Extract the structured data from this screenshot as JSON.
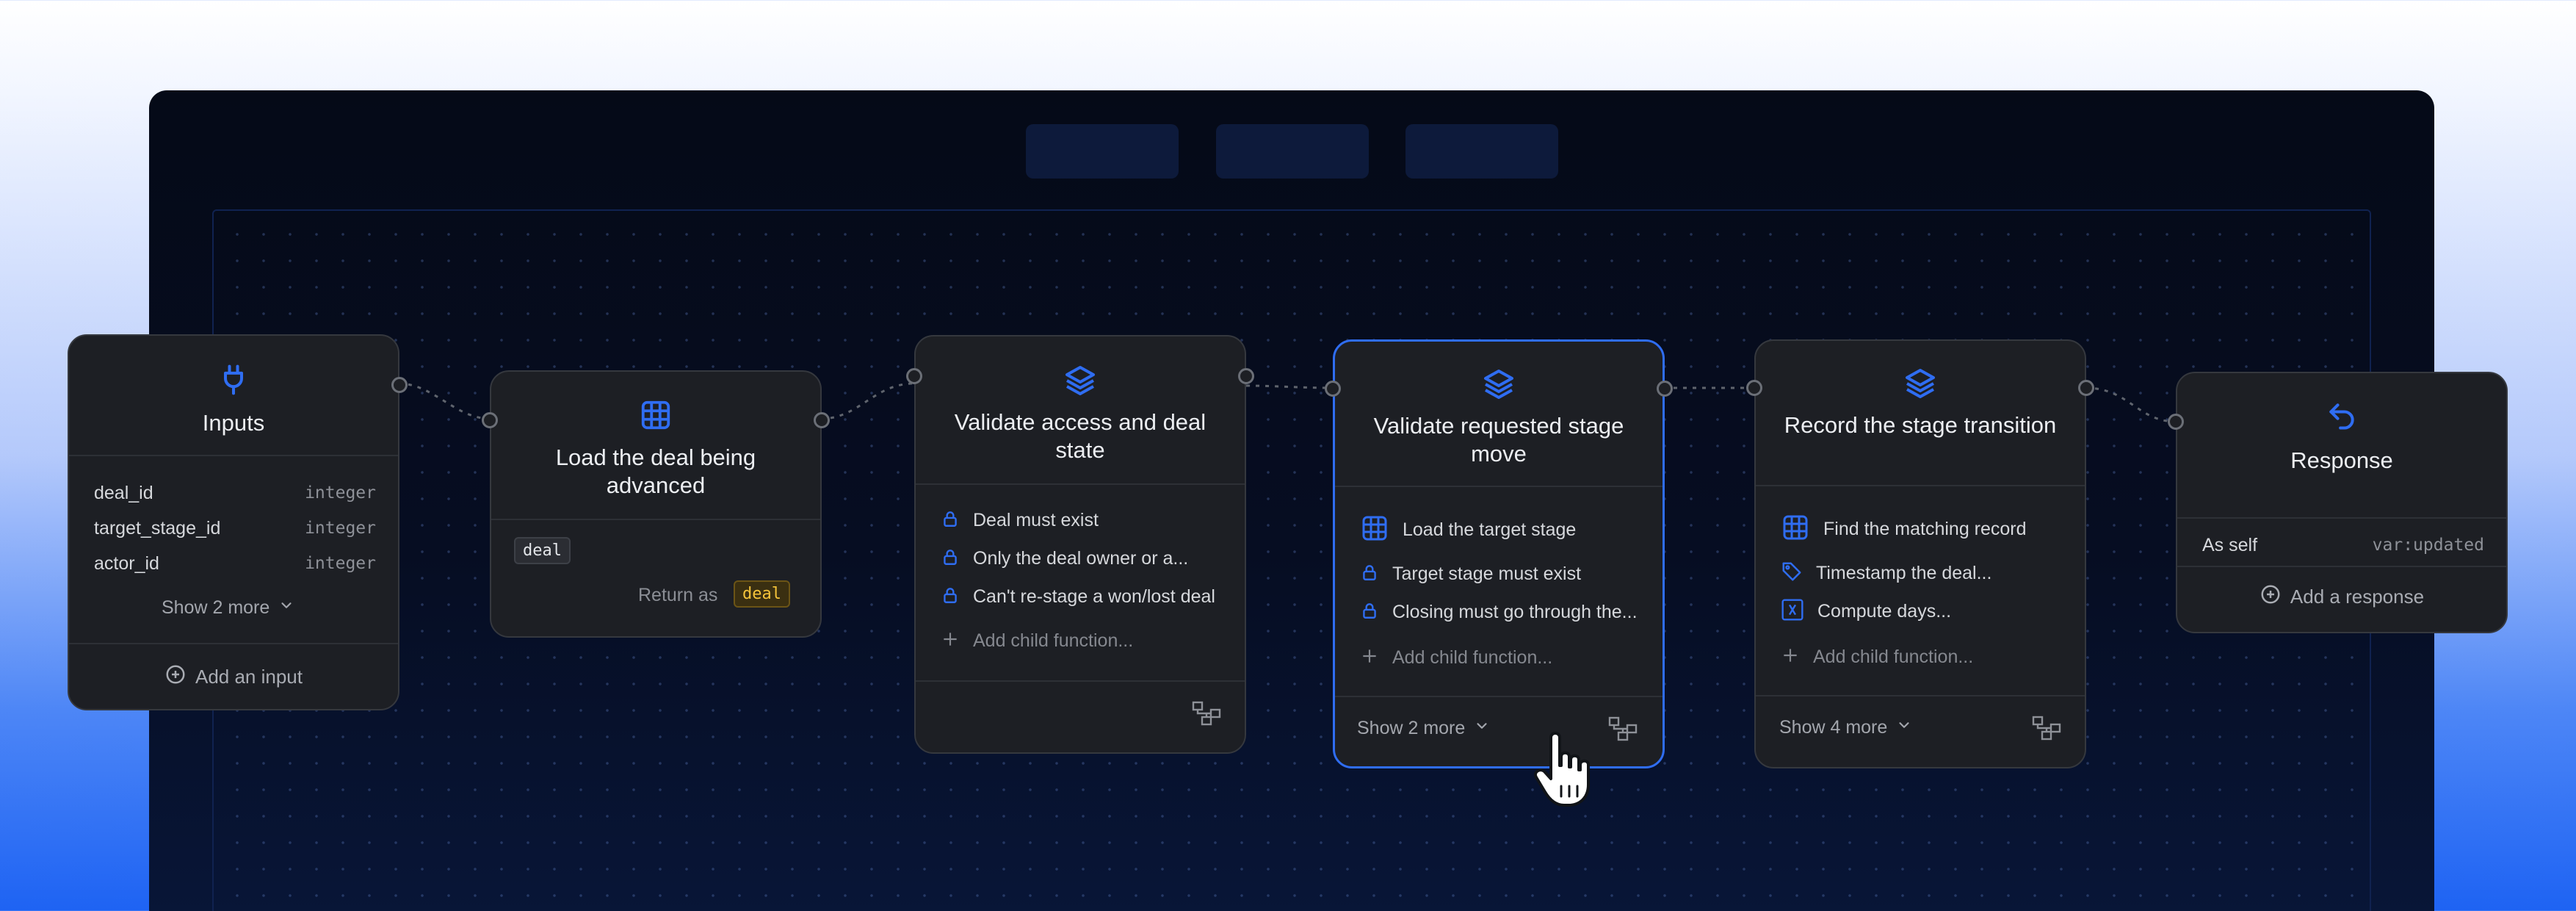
{
  "colors": {
    "accent": "#2f6df2",
    "node_bg": "#1d1f24",
    "chip_yellow": "#f4c33a"
  },
  "nodes": {
    "inputs": {
      "icon": "plug-icon",
      "title": "Inputs",
      "rows": [
        {
          "name": "deal_id",
          "type": "integer"
        },
        {
          "name": "target_stage_id",
          "type": "integer"
        },
        {
          "name": "actor_id",
          "type": "integer"
        }
      ],
      "show_more": "Show 2 more",
      "add": "Add an input"
    },
    "load_deal": {
      "icon": "table-icon",
      "title": "Load the deal being advanced",
      "chip": "deal",
      "return_label": "Return as",
      "return_chip": "deal"
    },
    "validate_access": {
      "icon": "layers-icon",
      "title": "Validate access and deal state",
      "steps": [
        {
          "icon": "lock-icon",
          "label": "Deal must exist"
        },
        {
          "icon": "lock-icon",
          "label": "Only the deal owner or a..."
        },
        {
          "icon": "lock-icon",
          "label": "Can't re-stage a won/lost deal"
        }
      ],
      "add_child": "Add child function..."
    },
    "validate_stage": {
      "icon": "layers-icon",
      "title": "Validate requested stage move",
      "steps": [
        {
          "icon": "table-icon",
          "label": "Load the target stage"
        },
        {
          "icon": "lock-icon",
          "label": "Target stage must exist"
        },
        {
          "icon": "lock-icon",
          "label": "Closing must go through the..."
        }
      ],
      "add_child": "Add child function...",
      "show_more": "Show 2 more"
    },
    "record_transition": {
      "icon": "layers-icon",
      "title": "Record the stage transition",
      "steps": [
        {
          "icon": "table-icon",
          "label": "Find the matching record"
        },
        {
          "icon": "tag-icon",
          "label": "Timestamp the deal..."
        },
        {
          "icon": "variable-icon",
          "label": "Compute days..."
        }
      ],
      "add_child": "Add child function...",
      "show_more": "Show 4 more"
    },
    "response": {
      "icon": "return-icon",
      "title": "Response",
      "row": {
        "name": "As self",
        "value": "var:updated"
      },
      "add": "Add a response"
    }
  }
}
